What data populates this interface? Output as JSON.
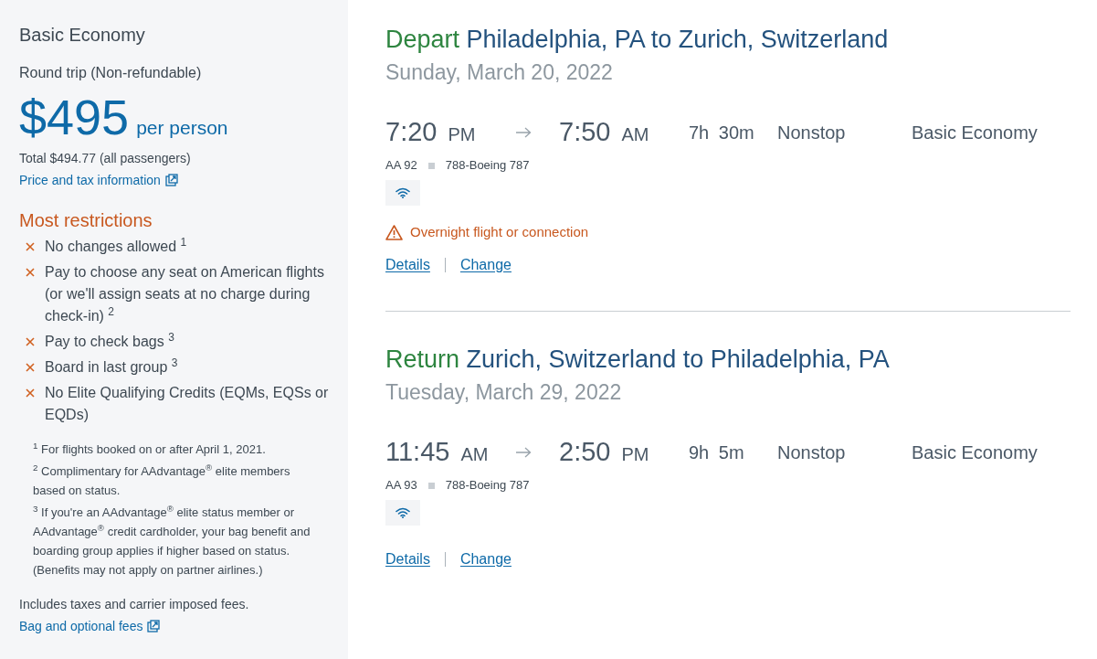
{
  "fare": {
    "title": "Basic Economy",
    "trip_type": "Round trip (Non-refundable)",
    "price": "$495",
    "price_unit": "per person",
    "total": "Total $494.77 (all passengers)",
    "price_link": "Price and tax information"
  },
  "restrictions": {
    "title": "Most restrictions",
    "items": [
      "No changes allowed $^{1}$",
      "Pay to choose any seat on American flights (or we'll assign seats at no charge during check-in) $^{2}$",
      "Pay to check bags $^{3}$",
      "Board in last group $^{3}$",
      "No Elite Qualifying Credits (EQMs, EQSs or EQDs)"
    ]
  },
  "footnotes": [
    "$^{1}$ For flights booked on or after April 1, 2021.",
    "$^{2}$ Complimentary for AAdvantage$^{®}$ elite members based on status.",
    "$^{3}$ If you're an AAdvantage$^{®}$ elite status member or AAdvantage$^{®}$ credit cardholder, your bag benefit and boarding group applies if higher based on status. (Benefits may not apply on partner airlines.)"
  ],
  "fees_note": "Includes taxes and carrier imposed fees.",
  "fees_link": "Bag and optional fees",
  "flights": [
    {
      "direction": "Depart",
      "route": "Philadelphia, PA to Zurich, Switzerland",
      "date": "Sunday, March 20, 2022",
      "depart_time": "7:20",
      "depart_period": "PM",
      "arrive_time": "7:50",
      "arrive_period": "AM",
      "duration": "7h 30m",
      "stops": "Nonstop",
      "cabin": "Basic Economy",
      "flight_number": "AA 92",
      "aircraft": "788-Boeing 787",
      "wifi": true,
      "warning": "Overnight flight or connection",
      "links": [
        "Details",
        "Change"
      ]
    },
    {
      "direction": "Return",
      "route": "Zurich, Switzerland to Philadelphia, PA",
      "date": "Tuesday, March 29, 2022",
      "depart_time": "11:45",
      "depart_period": "AM",
      "arrive_time": "2:50",
      "arrive_period": "PM",
      "duration": "9h 5m",
      "stops": "Nonstop",
      "cabin": "Basic Economy",
      "flight_number": "AA 93",
      "aircraft": "788-Boeing 787",
      "wifi": true,
      "links": [
        "Details",
        "Change"
      ]
    }
  ]
}
